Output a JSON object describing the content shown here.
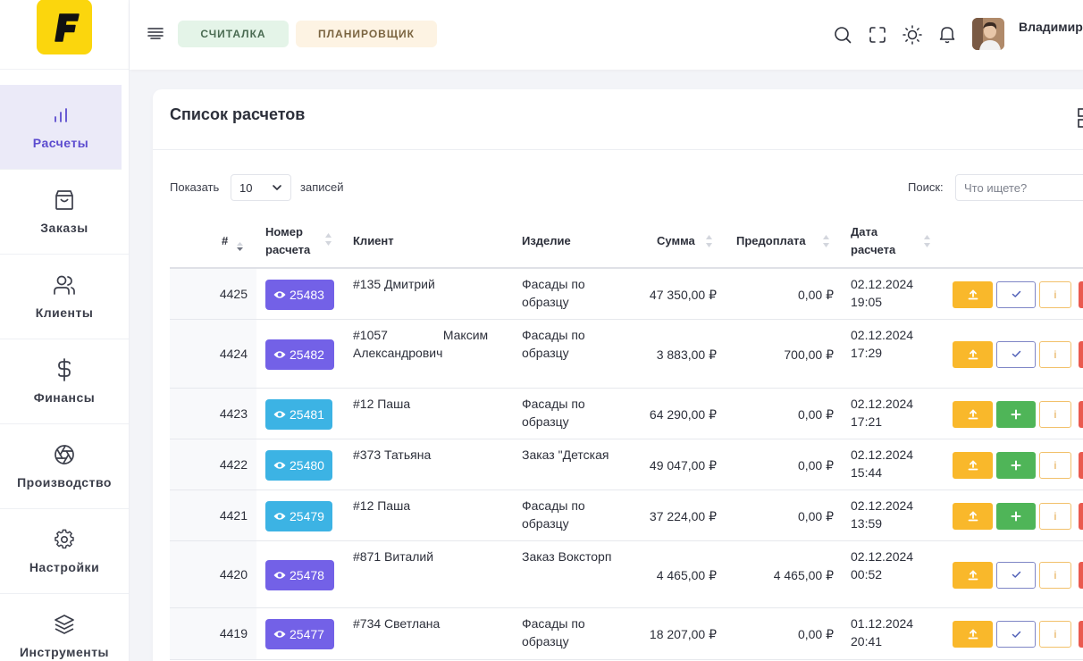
{
  "app": {
    "logo_letter": "F",
    "brand_color": "#fbd60d",
    "accent": "#5c4ccf"
  },
  "sidebar": {
    "items": [
      {
        "label": "Расчеты",
        "icon": "bar-chart-icon",
        "active": true
      },
      {
        "label": "Заказы",
        "icon": "shopping-bag-icon",
        "active": false
      },
      {
        "label": "Клиенты",
        "icon": "users-icon",
        "active": false
      },
      {
        "label": "Финансы",
        "icon": "dollar-icon",
        "active": false
      },
      {
        "label": "Производство",
        "icon": "aperture-icon",
        "active": false
      },
      {
        "label": "Настройки",
        "icon": "gear-icon",
        "active": false
      },
      {
        "label": "Инструменты",
        "icon": "layers-icon",
        "active": false
      }
    ]
  },
  "topbar": {
    "tab_calc": "СЧИТАЛКА",
    "tab_planner": "ПЛАНИРОВЩИК",
    "icons": [
      "search-icon",
      "fullscreen-icon",
      "sun-icon",
      "bell-icon"
    ],
    "user_name": "Владимир ..."
  },
  "card": {
    "title": "Список расчетов",
    "show_label": "Показать",
    "show_value": "10",
    "records_label": "записей",
    "search_label": "Поиск:",
    "search_placeholder": "Что ищете?"
  },
  "table": {
    "headers": {
      "id": "#",
      "number_1": "Номер",
      "number_2": "расчета",
      "client": "Клиент",
      "product": "Изделие",
      "sum": "Сумма",
      "prepay": "Предоплата",
      "date_1": "Дата",
      "date_2": "расчета"
    },
    "rows": [
      {
        "id": "4425",
        "num": "25483",
        "badge": "purple",
        "client_1": "#135 Дмитрий",
        "client_2": "",
        "product_1": "Фасады по",
        "product_2": "образцу",
        "sum": "47 350,00 ₽",
        "prepay": "0,00 ₽",
        "date": "02.12.2024",
        "time": "19:05",
        "action": "check"
      },
      {
        "id": "4424",
        "num": "25482",
        "badge": "purple",
        "client_1": "#1057 Максим",
        "client_2": "Александрович",
        "product_1": "Фасады по",
        "product_2": "образцу",
        "sum": "3 883,00 ₽",
        "prepay": "700,00 ₽",
        "date": "02.12.2024",
        "time": "17:29",
        "action": "check"
      },
      {
        "id": "4423",
        "num": "25481",
        "badge": "cyan",
        "client_1": "#12 Паша",
        "client_2": "",
        "product_1": "Фасады по",
        "product_2": "образцу",
        "sum": "64 290,00 ₽",
        "prepay": "0,00 ₽",
        "date": "02.12.2024",
        "time": "17:21",
        "action": "plus"
      },
      {
        "id": "4422",
        "num": "25480",
        "badge": "cyan",
        "client_1": "#373 Татьяна",
        "client_2": "",
        "product_1": "Заказ \"Детская",
        "product_2": "",
        "sum": "49 047,00 ₽",
        "prepay": "0,00 ₽",
        "date": "02.12.2024",
        "time": "15:44",
        "action": "plus"
      },
      {
        "id": "4421",
        "num": "25479",
        "badge": "cyan",
        "client_1": "#12 Паша",
        "client_2": "",
        "product_1": "Фасады по",
        "product_2": "образцу",
        "sum": "37 224,00 ₽",
        "prepay": "0,00 ₽",
        "date": "02.12.2024",
        "time": "13:59",
        "action": "plus"
      },
      {
        "id": "4420",
        "num": "25478",
        "badge": "purple",
        "client_1": "#871 Виталий",
        "client_2": "",
        "product_1": "Заказ Воксторп",
        "product_2": "",
        "sum": "4 465,00 ₽",
        "prepay": "4 465,00 ₽",
        "date": "02.12.2024",
        "time": "00:52",
        "action": "check"
      },
      {
        "id": "4419",
        "num": "25477",
        "badge": "purple",
        "client_1": "#734 Светлана",
        "client_2": "",
        "product_1": "Фасады по",
        "product_2": "образцу",
        "sum": "18 207,00 ₽",
        "prepay": "0,00 ₽",
        "date": "01.12.2024",
        "time": "20:41",
        "action": "check"
      }
    ],
    "info_glyph": "i"
  }
}
